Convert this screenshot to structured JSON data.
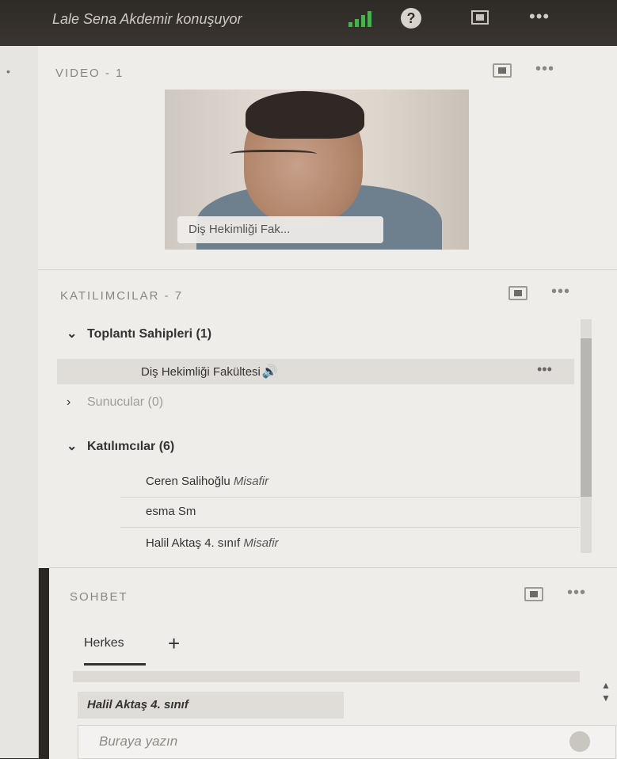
{
  "topbar": {
    "speaking": "Lale Sena Akdemir konuşuyor"
  },
  "video_pod": {
    "title": "VIDEO - 1",
    "more": "•••",
    "video_label": "Diş Hekimliği Fak..."
  },
  "attendees_pod": {
    "title": "KATILIMCILAR - 7",
    "more": "•••",
    "groups": [
      {
        "label": "Toplantı Sahipleri (1)",
        "expanded": true
      },
      {
        "label": "Sunucular (0)",
        "expanded": false
      },
      {
        "label": "Katılımcılar (6)",
        "expanded": true
      }
    ],
    "hosts": [
      {
        "name": "Diş Hekimliği Fakültesi",
        "more": "•••"
      }
    ],
    "participants": [
      {
        "name": "Ceren Salihoğlu",
        "role": "Misafir"
      },
      {
        "name": "esma Sm",
        "role": ""
      },
      {
        "name": "Halil Aktaş 4. sınıf",
        "role": "Misafir"
      }
    ]
  },
  "chat_pod": {
    "title": "SOHBET",
    "more": "•••",
    "tab": "Herkes",
    "add_tab": "+",
    "recipient": "Halil Aktaş 4. sınıf",
    "placeholder": "Buraya yazın"
  },
  "colors": {
    "signal": "#4caf50",
    "topbar": "#2e2a26",
    "pod_bg": "#efedea"
  }
}
